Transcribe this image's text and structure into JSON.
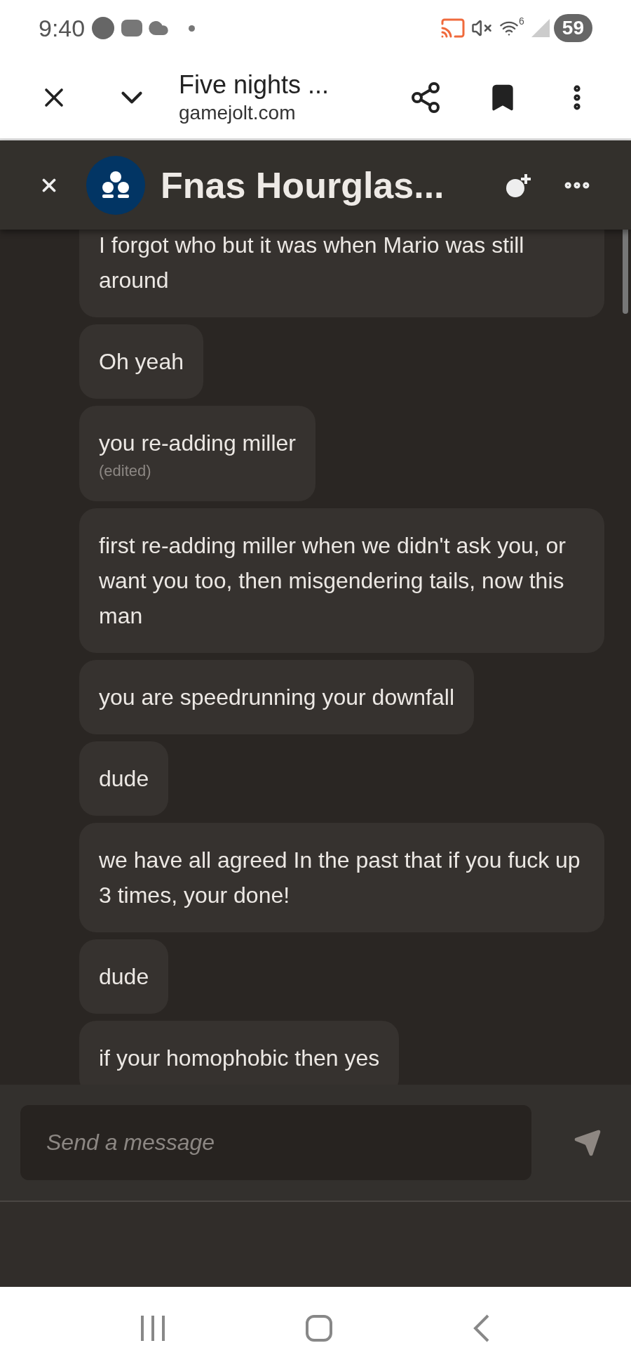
{
  "status_bar": {
    "time": "9:40",
    "wifi_label": "6",
    "battery": "59"
  },
  "browser": {
    "title": "Five nights ...",
    "url": "gamejolt.com"
  },
  "chat": {
    "title": "Fnas Hourglas..."
  },
  "messages": [
    {
      "text": "I forgot who but it was when Mario was still around"
    },
    {
      "text": "Oh yeah"
    },
    {
      "text": "you re-adding miller",
      "edited_label": "(edited)"
    },
    {
      "text": "first re-adding miller when we didn't ask you, or want you too, then misgendering tails, now this man"
    },
    {
      "text": "you are speedrunning your downfall"
    },
    {
      "text": "dude"
    },
    {
      "text": "we have all agreed In the past that if you fuck up 3 times, your done!"
    },
    {
      "text": "dude"
    },
    {
      "text": "if your homophobic then yes"
    }
  ],
  "composer": {
    "placeholder": "Send a message"
  }
}
